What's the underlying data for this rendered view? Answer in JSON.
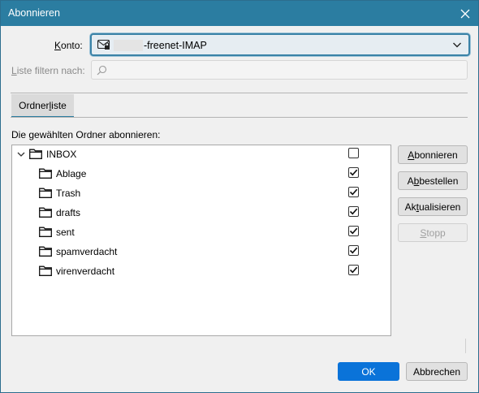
{
  "window": {
    "title": "Abonnieren"
  },
  "account": {
    "label": "Konto:",
    "label_underline": "K",
    "label_rest": "onto:",
    "value": "-freenet-IMAP"
  },
  "filter": {
    "label_underline": "L",
    "label_rest": "iste filtern nach:",
    "value": ""
  },
  "tab": {
    "label_before": "Ordner",
    "label_underline": "l",
    "label_after": "iste"
  },
  "list": {
    "heading": "Die gewählten Ordner abonnieren:",
    "folders": [
      {
        "name": "INBOX",
        "subscribed": false,
        "level": 0
      },
      {
        "name": "Ablage",
        "subscribed": true,
        "level": 1
      },
      {
        "name": "Trash",
        "subscribed": true,
        "level": 1
      },
      {
        "name": "drafts",
        "subscribed": true,
        "level": 1
      },
      {
        "name": "sent",
        "subscribed": true,
        "level": 1
      },
      {
        "name": "spamverdacht",
        "subscribed": true,
        "level": 1
      },
      {
        "name": "virenverdacht",
        "subscribed": true,
        "level": 1
      }
    ]
  },
  "buttons": {
    "subscribe": {
      "underline": "A",
      "rest": "bonnieren"
    },
    "unsubscribe": {
      "before": "A",
      "underline": "b",
      "rest": "bestellen"
    },
    "refresh": {
      "before": "Ak",
      "underline": "t",
      "rest": "ualisieren"
    },
    "stop": {
      "underline": "S",
      "rest": "topp"
    },
    "ok": "OK",
    "cancel": "Abbrechen"
  },
  "colors": {
    "titlebar": "#2b7da1",
    "accent": "#0a73d9"
  }
}
